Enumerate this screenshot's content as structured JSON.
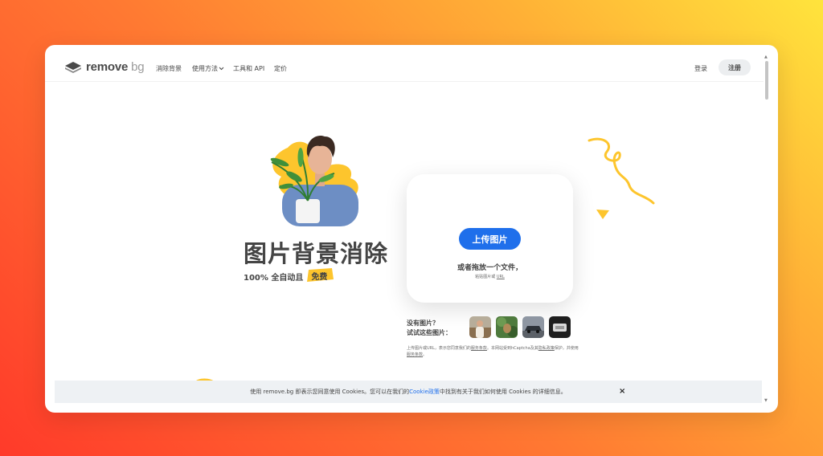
{
  "header": {
    "logo_text": "remove",
    "logo_suffix": "bg",
    "nav": [
      {
        "label": "消除背景"
      },
      {
        "label": "使用方法"
      },
      {
        "label": "工具和 API"
      },
      {
        "label": "定价"
      }
    ],
    "login_label": "登录",
    "signup_label": "注册"
  },
  "hero": {
    "title": "图片背景消除",
    "subtitle": "100% 全自动且",
    "free_badge": "免费"
  },
  "upload": {
    "button_label": "上传图片",
    "drop_text": "或者拖放一个文件，",
    "paste_text": "粘贴图片或",
    "paste_link": "URL"
  },
  "samples": {
    "label_line1": "没有图片？",
    "label_line2": "试试这些图片："
  },
  "terms": {
    "part1": "上传图片或URL，表示您同意我们的",
    "link1": "服务条款",
    "part2": "。本网站受到hCaptcha及其",
    "link2": "隐私政策",
    "part3": "保护，并使用",
    "link3": "服务条款",
    "part4": "。"
  },
  "cookie": {
    "text_before": "使用 remove.bg 即表示您同意使用 Cookies。您可以在我们的",
    "link": "Cookie政策",
    "text_after": "中找到有关于我们如何使用 Cookies 的详细信息。",
    "close": "×"
  },
  "colors": {
    "accent": "#1f6feb",
    "yellow": "#fdc52d",
    "text": "#454545"
  }
}
